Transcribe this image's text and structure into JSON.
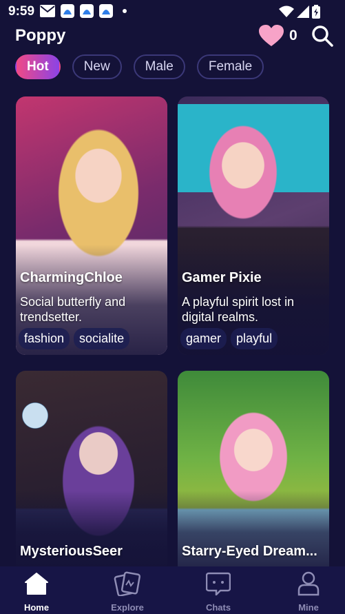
{
  "status_bar": {
    "time": "9:59"
  },
  "header": {
    "title": "Poppy",
    "likes_count": "0"
  },
  "tabs": [
    {
      "label": "Hot",
      "active": true
    },
    {
      "label": "New",
      "active": false
    },
    {
      "label": "Male",
      "active": false
    },
    {
      "label": "Female",
      "active": false
    }
  ],
  "cards": [
    {
      "name": "CharmingChloe",
      "description": "Social butterfly and trendsetter.",
      "tags": [
        "fashion",
        "socialite"
      ]
    },
    {
      "name": "Gamer Pixie",
      "description": "A playful spirit lost in digital realms.",
      "tags": [
        "gamer",
        "playful"
      ]
    },
    {
      "name": "MysteriousSeer"
    },
    {
      "name": "Starry-Eyed Dream..."
    }
  ],
  "bottom_nav": [
    {
      "label": "Home",
      "icon": "home-icon",
      "active": true
    },
    {
      "label": "Explore",
      "icon": "cards-icon",
      "active": false
    },
    {
      "label": "Chats",
      "icon": "chat-icon",
      "active": false
    },
    {
      "label": "Mine",
      "icon": "user-icon",
      "active": false
    }
  ],
  "colors": {
    "background": "#141238",
    "tab_gradient_start": "#f04a86",
    "tab_gradient_end": "#8b43e6",
    "heart": "#f7a3c8"
  }
}
